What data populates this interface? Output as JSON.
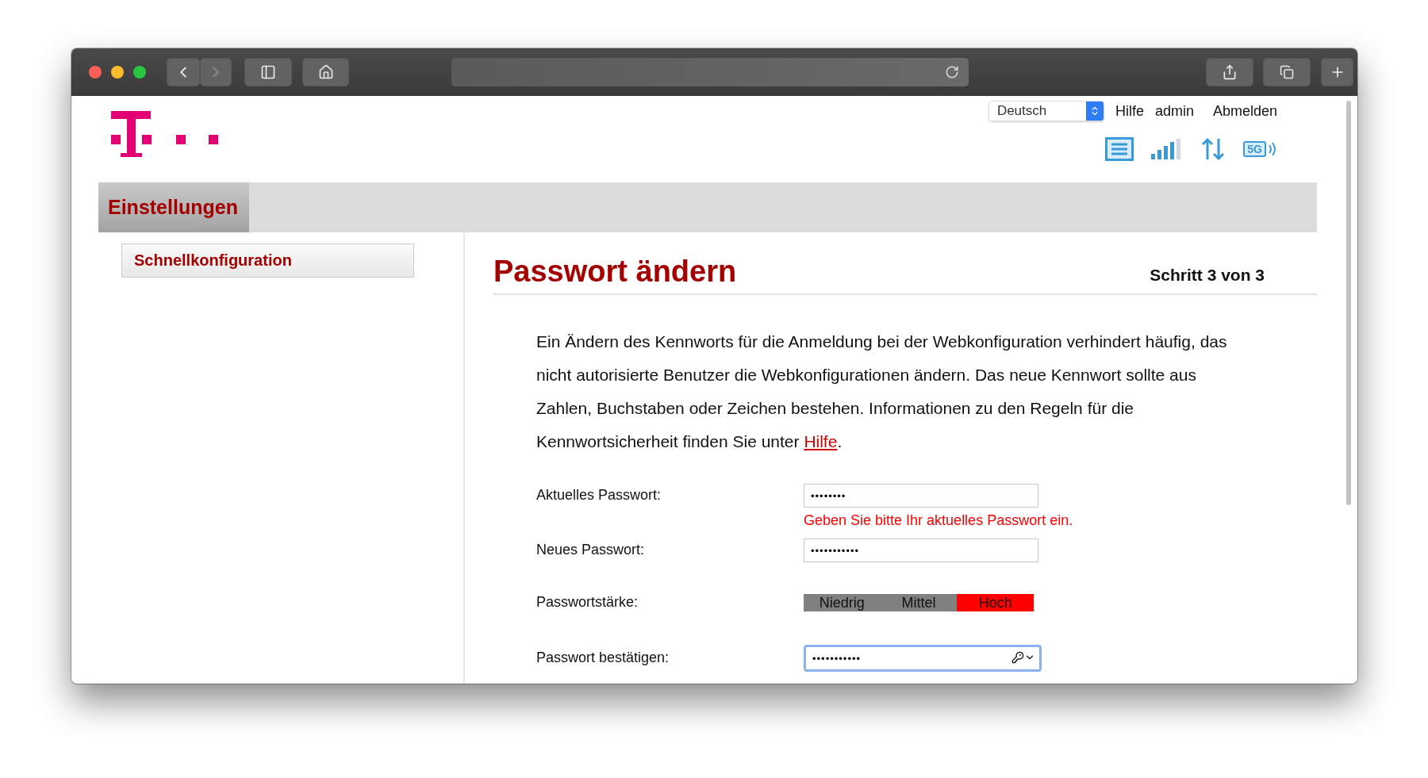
{
  "browser": {
    "back": {
      "disabled": false
    },
    "forward": {
      "disabled": true
    }
  },
  "header": {
    "language": "Deutsch",
    "links": [
      "Hilfe",
      "admin",
      "Abmelden"
    ],
    "network_type": "5G"
  },
  "nav": {
    "tabs": [
      {
        "label": "Einstellungen",
        "selected": true
      }
    ]
  },
  "sidebar": {
    "items": [
      "Schnellkonfiguration"
    ]
  },
  "main": {
    "title": "Passwort ändern",
    "step": "Schritt 3 von 3",
    "intro": {
      "text": "Ein Ändern des Kennworts für die Anmeldung bei der Webkonfiguration verhindert häufig, das nicht autorisierte Benutzer die Webkonfigurationen ändern. Das neue Kennwort sollte aus Zahlen, Buchstaben oder Zeichen bestehen. Informationen zu den Regeln für die Kennwortsicherheit finden Sie unter",
      "link": "Hilfe",
      "after": "."
    },
    "fields": [
      {
        "kind": "password",
        "label": "Aktuelles Passwort:",
        "value": "••••••••",
        "focused": false,
        "error": "Geben Sie bitte Ihr aktuelles Passwort ein."
      },
      {
        "kind": "password",
        "label": "Neues Passwort:",
        "value": "•••••••••••",
        "focused": false
      },
      {
        "kind": "strength",
        "label": "Passwortstärke:",
        "levels": [
          {
            "label": "Niedrig",
            "selected": false
          },
          {
            "label": "Mittel",
            "selected": false
          },
          {
            "label": "Hoch",
            "selected": true
          }
        ]
      },
      {
        "kind": "password",
        "label": "Passwort bestätigen:",
        "value": "•••••••••••",
        "focused": true
      }
    ]
  }
}
